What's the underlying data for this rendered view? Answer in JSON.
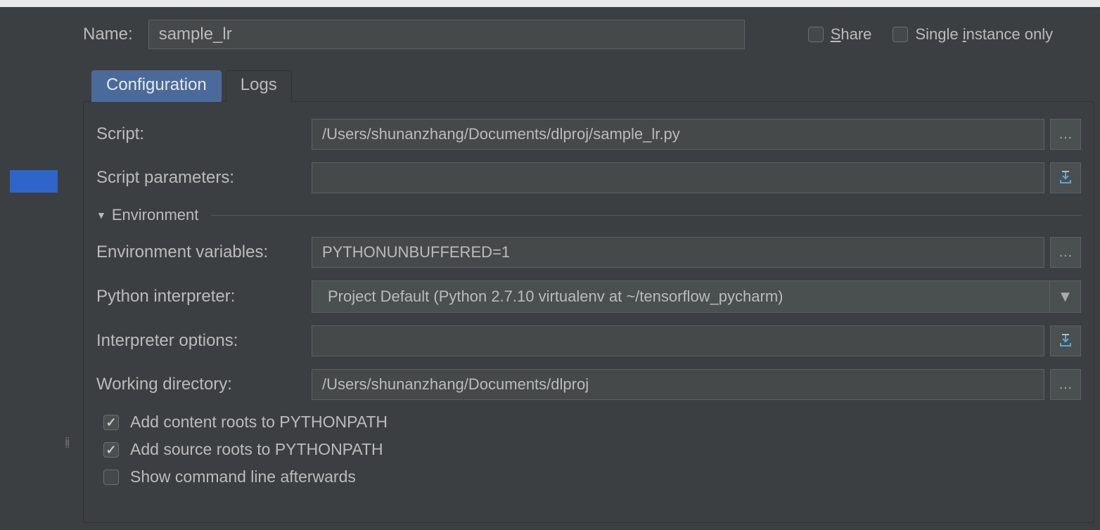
{
  "header": {
    "name_label": "Name:",
    "name_value": "sample_lr",
    "share_label": "Share",
    "share_checked": false,
    "single_instance_label": "Single instance only",
    "single_instance_checked": false
  },
  "tabs": {
    "configuration": "Configuration",
    "logs": "Logs",
    "active": "configuration"
  },
  "fields": {
    "script_label": "Script:",
    "script_value": "/Users/shunanzhang/Documents/dlproj/sample_lr.py",
    "script_params_label": "Script parameters:",
    "script_params_value": "",
    "environment_section": "Environment",
    "env_vars_label": "Environment variables:",
    "env_vars_value": "PYTHONUNBUFFERED=1",
    "interpreter_label": "Python interpreter:",
    "interpreter_value": "Project Default (Python 2.7.10 virtualenv at ~/tensorflow_pycharm)",
    "interpreter_options_label": "Interpreter options:",
    "interpreter_options_value": "",
    "working_dir_label": "Working directory:",
    "working_dir_value": "/Users/shunanzhang/Documents/dlproj"
  },
  "checks": {
    "add_content_roots": "Add content roots to PYTHONPATH",
    "add_content_roots_checked": true,
    "add_source_roots": "Add source roots to PYTHONPATH",
    "add_source_roots_checked": true,
    "show_cmd_line": "Show command line afterwards",
    "show_cmd_line_checked": false
  }
}
